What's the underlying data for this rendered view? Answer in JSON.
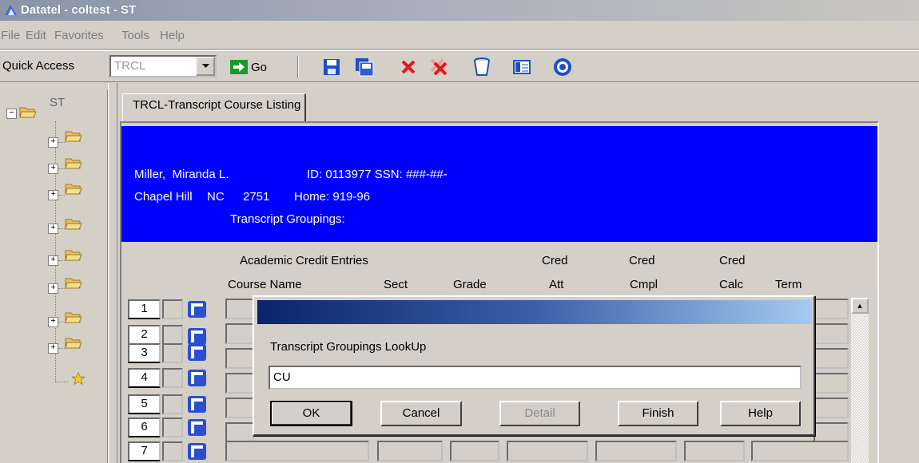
{
  "window": {
    "title": "Datatel - coltest - ST"
  },
  "menu": [
    "File",
    "Edit",
    "Favorites",
    "Tools",
    "Help"
  ],
  "toolbar": {
    "quick_access_label": "Quick Access",
    "quick_access_value": "TRCL",
    "go_label": "Go",
    "icons": [
      "save-icon",
      "save-all-icon",
      "cancel-icon",
      "cancel-all-icon",
      "delete-icon",
      "detail-icon",
      "help-icon"
    ]
  },
  "tree": {
    "root_label": "ST",
    "folders": 8
  },
  "tab": {
    "label": "TRCL-Transcript Course Listing"
  },
  "person": {
    "name": "Miller,  Miranda L.",
    "id_text": "ID: 0113977 SSN: ###-##-",
    "city": "Chapel Hill",
    "state": "NC",
    "zip": "2751",
    "home": "Home: 919-96",
    "groupings_label": "Transcript Groupings:"
  },
  "grid": {
    "section_title": "Academic Credit Entries",
    "headers_top": [
      "Cred",
      "Cred",
      "Cred"
    ],
    "headers": [
      "Course Name",
      "Sect",
      "Grade",
      "Att",
      "Cmpl",
      "Calc",
      "Term"
    ],
    "rows": [
      "1",
      "2",
      "3",
      "4",
      "5",
      "6",
      "7"
    ]
  },
  "dialog": {
    "label": "Transcript Groupings LookUp",
    "input_value": "CU",
    "buttons": {
      "ok": "OK",
      "cancel": "Cancel",
      "detail": "Detail",
      "finish": "Finish",
      "help": "Help"
    }
  },
  "colors": {
    "header_band": "#0000ff",
    "chrome": "#d4d0c8"
  }
}
